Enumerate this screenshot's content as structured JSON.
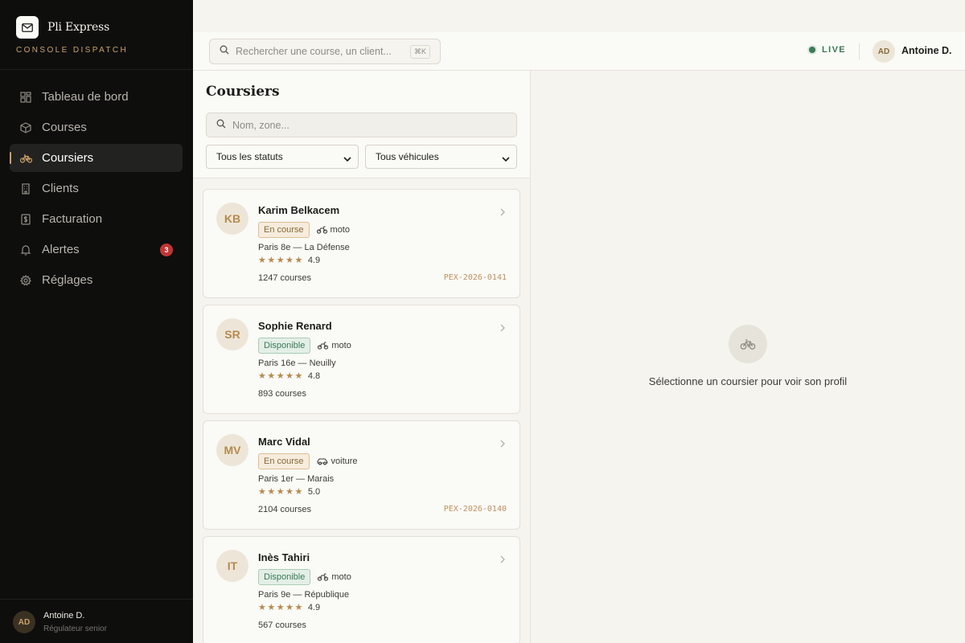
{
  "brand": {
    "name": "Pli Express",
    "subtitle": "CONSOLE DISPATCH"
  },
  "nav": [
    {
      "label": "Tableau de bord",
      "icon": "dashboard-icon"
    },
    {
      "label": "Courses",
      "icon": "package-icon"
    },
    {
      "label": "Coursiers",
      "icon": "bike-icon",
      "active": true
    },
    {
      "label": "Clients",
      "icon": "building-icon"
    },
    {
      "label": "Facturation",
      "icon": "invoice-icon"
    },
    {
      "label": "Alertes",
      "icon": "bell-icon",
      "badge": "3"
    },
    {
      "label": "Réglages",
      "icon": "gear-icon"
    }
  ],
  "sidebar_user": {
    "initials": "AD",
    "name": "Antoine D.",
    "role": "Régulateur senior"
  },
  "topbar": {
    "search_placeholder": "Rechercher une course, un client...",
    "shortcut": "⌘K",
    "live_label": "LIVE",
    "user_initials": "AD",
    "user_name": "Antoine D."
  },
  "panel": {
    "title": "Coursiers",
    "search_placeholder": "Nom, zone...",
    "status_filter": "Tous les statuts",
    "vehicle_filter": "Tous véhicules"
  },
  "couriers": [
    {
      "initials": "KB",
      "name": "Karim Belkacem",
      "status": "En course",
      "vehicle": "moto",
      "zone": "Paris 8e — La Défense",
      "rating": "4.9",
      "courses": "1247 courses",
      "ref": "PEX-2026-0141"
    },
    {
      "initials": "SR",
      "name": "Sophie Renard",
      "status": "Disponible",
      "vehicle": "moto",
      "zone": "Paris 16e — Neuilly",
      "rating": "4.8",
      "courses": "893 courses",
      "ref": ""
    },
    {
      "initials": "MV",
      "name": "Marc Vidal",
      "status": "En course",
      "vehicle": "voiture",
      "zone": "Paris 1er — Marais",
      "rating": "5.0",
      "courses": "2104 courses",
      "ref": "PEX-2026-0140"
    },
    {
      "initials": "IT",
      "name": "Inès Tahiri",
      "status": "Disponible",
      "vehicle": "moto",
      "zone": "Paris 9e — République",
      "rating": "4.9",
      "courses": "567 courses",
      "ref": ""
    }
  ],
  "stars": "★★★★★",
  "empty_state": "Sélectionne un coursier pour voir son profil",
  "colors": {
    "accent": "#c9a06a",
    "sidebar_bg": "#0e0e0d",
    "live_green": "#3d7a57",
    "badge_red": "#c43434"
  }
}
